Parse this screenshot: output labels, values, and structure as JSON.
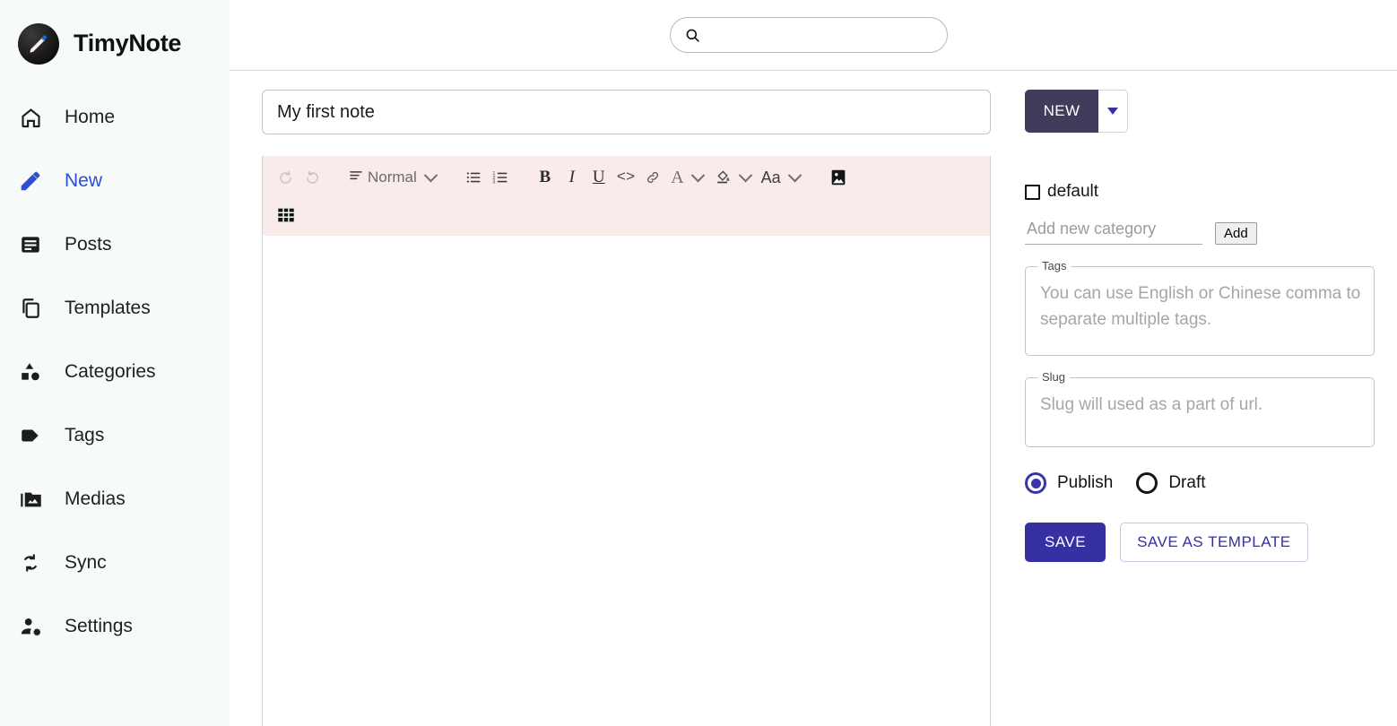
{
  "brand": {
    "name": "TimyNote",
    "logo_icon": "pencil-circle-logo"
  },
  "sidebar": {
    "items": [
      {
        "label": "Home",
        "icon": "home-icon",
        "active": false
      },
      {
        "label": "New",
        "icon": "pencil-icon",
        "active": true
      },
      {
        "label": "Posts",
        "icon": "article-icon",
        "active": false
      },
      {
        "label": "Templates",
        "icon": "copy-icon",
        "active": false
      },
      {
        "label": "Categories",
        "icon": "shapes-icon",
        "active": false
      },
      {
        "label": "Tags",
        "icon": "tag-icon",
        "active": false
      },
      {
        "label": "Medias",
        "icon": "image-folder-icon",
        "active": false
      },
      {
        "label": "Sync",
        "icon": "sync-icon",
        "active": false
      },
      {
        "label": "Settings",
        "icon": "manage-accounts-icon",
        "active": false
      }
    ]
  },
  "topbar": {
    "search": {
      "icon": "search-icon",
      "value": "",
      "placeholder": ""
    }
  },
  "editor": {
    "title_value": "My first note",
    "title_placeholder": "",
    "body_value": "",
    "toolbar": {
      "undo": {
        "icon": "undo-icon",
        "label": "",
        "disabled": true
      },
      "redo": {
        "icon": "redo-icon",
        "label": "",
        "disabled": true
      },
      "block_format": {
        "icon": "paragraph-format-icon",
        "label": "Normal"
      },
      "bullet_list": {
        "icon": "bulleted-list-icon"
      },
      "numbered_list": {
        "icon": "numbered-list-icon"
      },
      "bold": {
        "icon": "bold-icon",
        "label": "B"
      },
      "italic": {
        "icon": "italic-icon",
        "label": "I"
      },
      "underline": {
        "icon": "underline-icon",
        "label": "U"
      },
      "code": {
        "icon": "code-icon",
        "label": "<>"
      },
      "link": {
        "icon": "link-icon"
      },
      "font_color": {
        "icon": "font-color-icon",
        "label": "A"
      },
      "highlight_color": {
        "icon": "fill-color-icon"
      },
      "font_size": {
        "icon": "font-size-icon",
        "label": "Aa"
      },
      "insert_image": {
        "icon": "insert-image-icon"
      },
      "insert_table": {
        "icon": "insert-table-icon"
      }
    }
  },
  "panel": {
    "new_button": {
      "label": "NEW",
      "caret_icon": "chevron-down-icon"
    },
    "category": {
      "checkbox_label": "default",
      "checked": false,
      "input_value": "",
      "input_placeholder": "Add new category",
      "add_button": "Add"
    },
    "tags": {
      "legend": "Tags",
      "value": "",
      "placeholder": "You can use English or Chinese comma to separate multiple tags."
    },
    "slug": {
      "legend": "Slug",
      "value": "",
      "placeholder": "Slug will used as a part of url."
    },
    "status": {
      "selected": "Publish",
      "options": [
        "Publish",
        "Draft"
      ]
    },
    "save_button": "SAVE",
    "save_template_button": "SAVE AS TEMPLATE"
  },
  "colors": {
    "accent_blue": "#2c4ed4",
    "indigo": "#3730a3",
    "new_button_bg": "#3f3c5c",
    "toolbar_bg": "#f8ebe9",
    "sidebar_bg": "#f6faf8"
  }
}
